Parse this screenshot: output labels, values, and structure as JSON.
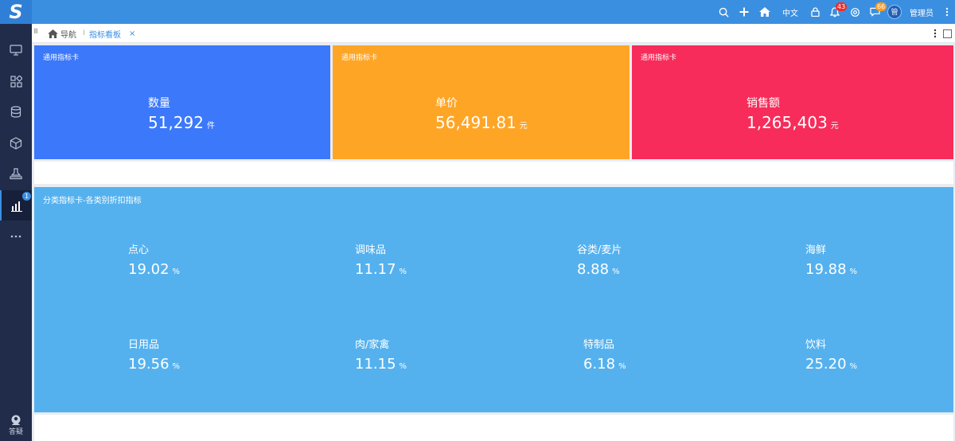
{
  "app": {
    "logo_text": "S"
  },
  "header": {
    "lang_label": "中文",
    "notifications_count": "43",
    "messages_count": "66",
    "avatar_text": "管",
    "user_name": "管理员"
  },
  "sidebar": {
    "items": [
      {
        "icon": "monitor-icon"
      },
      {
        "icon": "grid-icon"
      },
      {
        "icon": "database-icon"
      },
      {
        "icon": "cube-icon"
      },
      {
        "icon": "stamp-icon"
      },
      {
        "icon": "bar-chart-icon",
        "active": true,
        "badge": "1"
      },
      {
        "icon": "more-icon"
      }
    ],
    "help_label": "答疑"
  },
  "tabs": {
    "home_label": "导航",
    "separator": "I",
    "active_label": "指标看板",
    "close_glyph": "×"
  },
  "cards": [
    {
      "title": "通用指标卡",
      "label": "数量",
      "value": "51,292",
      "unit": "件",
      "color": "#3b78fa"
    },
    {
      "title": "通用指标卡",
      "label": "单价",
      "value": "56,491.81",
      "unit": "元",
      "color": "#ffa526"
    },
    {
      "title": "通用指标卡",
      "label": "销售额",
      "value": "1,265,403",
      "unit": "元",
      "color": "#f72c5a"
    }
  ],
  "category_panel": {
    "title": "分类指标卡-各类别折扣指标",
    "color": "#55b1ee",
    "items": [
      {
        "label": "点心",
        "value": "19.02",
        "unit": "%"
      },
      {
        "label": "调味品",
        "value": "11.17",
        "unit": "%"
      },
      {
        "label": "谷类/麦片",
        "value": "8.88",
        "unit": "%"
      },
      {
        "label": "海鲜",
        "value": "19.88",
        "unit": "%"
      },
      {
        "label": "日用品",
        "value": "19.56",
        "unit": "%"
      },
      {
        "label": "肉/家禽",
        "value": "11.15",
        "unit": "%"
      },
      {
        "label": "特制品",
        "value": "6.18",
        "unit": "%"
      },
      {
        "label": "饮料",
        "value": "25.20",
        "unit": "%"
      }
    ]
  }
}
